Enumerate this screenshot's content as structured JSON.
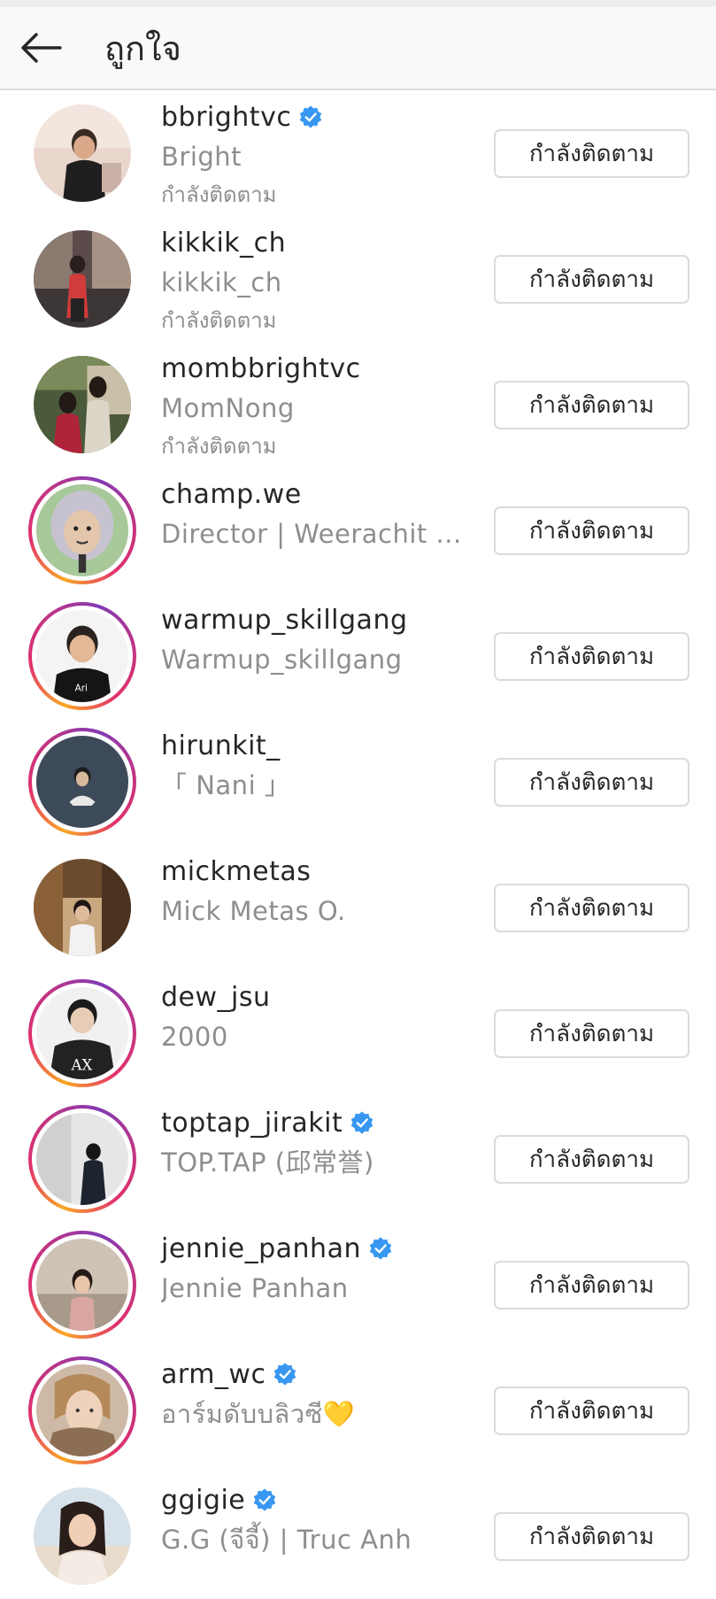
{
  "header": {
    "title": "ถูกใจ",
    "back_icon": "arrow-left-icon"
  },
  "colors": {
    "verified": "#3897f0",
    "story_ring_start": "#f9a825",
    "story_ring_end": "#c13584",
    "secondary_text": "#8e8e8e",
    "button_border": "#dbdbdb"
  },
  "users": [
    {
      "username": "bbrightvc",
      "verified": true,
      "full_name": "Bright",
      "status": "กำลังติดตาม",
      "button": "กำลังติดตาม",
      "story_ring": false
    },
    {
      "username": "kikkik_ch",
      "verified": false,
      "full_name": "kikkik_ch",
      "status": "กำลังติดตาม",
      "button": "กำลังติดตาม",
      "story_ring": false
    },
    {
      "username": "mombbrightvc",
      "verified": false,
      "full_name": "MomNong",
      "status": "กำลังติดตาม",
      "button": "กำลังติดตาม",
      "story_ring": false
    },
    {
      "username": "champ.we",
      "verified": false,
      "full_name": "Director | Weerachit ...",
      "status": "",
      "button": "กำลังติดตาม",
      "story_ring": true
    },
    {
      "username": "warmup_skillgang",
      "verified": false,
      "full_name": "Warmup_skillgang",
      "status": "",
      "button": "กำลังติดตาม",
      "story_ring": true
    },
    {
      "username": "hirunkit_",
      "verified": false,
      "full_name": "「 Nani 」",
      "status": "",
      "button": "กำลังติดตาม",
      "story_ring": true
    },
    {
      "username": "mickmetas",
      "verified": false,
      "full_name": "Mick Metas O.",
      "status": "",
      "button": "กำลังติดตาม",
      "story_ring": false
    },
    {
      "username": "dew_jsu",
      "verified": false,
      "full_name": "2000",
      "status": "",
      "button": "กำลังติดตาม",
      "story_ring": true
    },
    {
      "username": "toptap_jirakit",
      "verified": true,
      "full_name": "TOP.TAP (邱常誉)",
      "status": "",
      "button": "กำลังติดตาม",
      "story_ring": true
    },
    {
      "username": "jennie_panhan",
      "verified": true,
      "full_name": "Jennie Panhan",
      "status": "",
      "button": "กำลังติดตาม",
      "story_ring": true
    },
    {
      "username": "arm_wc",
      "verified": true,
      "full_name": "อาร์มดับบลิวซี💛",
      "status": "",
      "button": "กำลังติดตาม",
      "story_ring": true
    },
    {
      "username": "ggigie",
      "verified": true,
      "full_name": "G.G (จีจี้) | Truc Anh",
      "status": "",
      "button": "กำลังติดตาม",
      "story_ring": false
    }
  ]
}
